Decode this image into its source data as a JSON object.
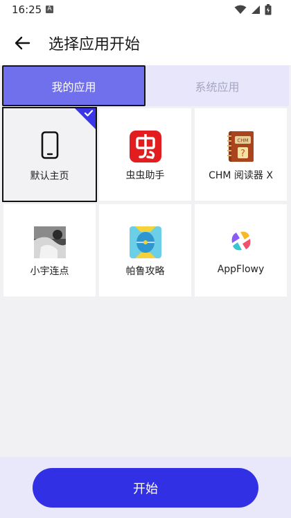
{
  "status": {
    "time": "16:25",
    "badge": "A"
  },
  "header": {
    "title": "选择应用开始"
  },
  "tabs": [
    {
      "label": "我的应用",
      "active": true
    },
    {
      "label": "系统应用",
      "active": false
    }
  ],
  "apps": [
    {
      "label": "默认主页",
      "icon": "phone-icon",
      "selected": true
    },
    {
      "label": "虫虫助手",
      "icon": "chongchong-icon",
      "selected": false
    },
    {
      "label": "CHM 阅读器 X",
      "icon": "chm-book-icon",
      "selected": false
    },
    {
      "label": "小宇连点",
      "icon": "xiaoyu-photo-icon",
      "selected": false
    },
    {
      "label": "帕鲁攻略",
      "icon": "palu-icon",
      "selected": false
    },
    {
      "label": "AppFlowy",
      "icon": "appflowy-icon",
      "selected": false
    }
  ],
  "footer": {
    "start_label": "开始"
  },
  "colors": {
    "accent": "#3230e4",
    "tab_active": "#7170ec",
    "tab_bg": "#e7e6fb"
  }
}
